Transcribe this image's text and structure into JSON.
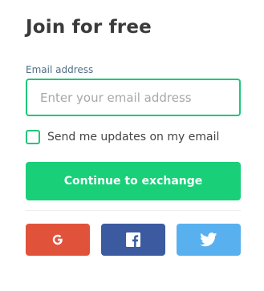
{
  "form": {
    "title": "Join for free",
    "email_label": "Email address",
    "email_placeholder": "Enter your email address",
    "email_value": "",
    "updates_checkbox_label": "Send me updates on my email",
    "updates_checked": false,
    "submit_label": "Continue to exchange"
  },
  "social": [
    {
      "provider": "google",
      "icon": "google-icon",
      "color": "#e0533a"
    },
    {
      "provider": "facebook",
      "icon": "facebook-icon",
      "color": "#3b5aa0"
    },
    {
      "provider": "twitter",
      "icon": "twitter-icon",
      "color": "#58b0ef"
    }
  ],
  "colors": {
    "accent_green": "#19cf78",
    "input_border": "#1ec77a",
    "label_blue": "#4f6e86",
    "title_text": "#3a3a3a"
  }
}
